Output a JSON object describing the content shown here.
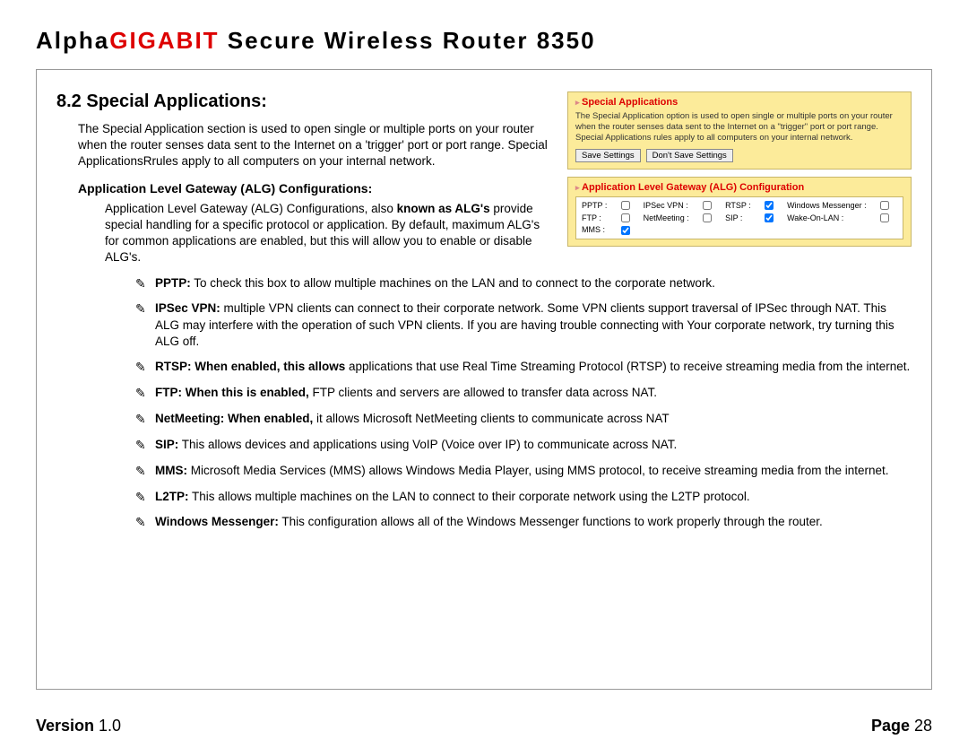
{
  "header": {
    "brand1": "Alpha",
    "brand2": "GIGABIT",
    "product": " Secure Wireless Router 8350"
  },
  "section": {
    "title": "8.2 Special Applications:"
  },
  "intro": "The Special Application section is used to open single or multiple ports on your router when the router senses data sent to the Internet on a 'trigger' port  or port range. Special ApplicationsRrules apply to all computers on your internal network.",
  "alg_heading": "Application Level Gateway (ALG) Configurations:",
  "alg_intro_pre": "Application Level Gateway (ALG) Configurations, also ",
  "alg_intro_bold": "known as ALG's",
  "alg_intro_post": " provide special handling for a specific protocol or application. By default, maximum ALG's for common applications are enabled, but this will allow you to enable or disable  ALG's.",
  "panel1": {
    "title": "Special Applications",
    "desc": "The Special Application option is used to open single or multiple ports on your router when the router senses data sent to the Internet on a \"trigger\" port or port range. Special Applications rules apply to all computers on your internal network.",
    "save": "Save Settings",
    "dont": "Don't Save Settings"
  },
  "panel2": {
    "title": "Application Level Gateway (ALG) Configuration",
    "opts": [
      {
        "label": "PPTP",
        "checked": false
      },
      {
        "label": "IPSec VPN",
        "checked": false
      },
      {
        "label": "RTSP",
        "checked": true
      },
      {
        "label": "Windows Messenger",
        "checked": false
      },
      {
        "label": "FTP",
        "checked": false
      },
      {
        "label": "NetMeeting",
        "checked": false
      },
      {
        "label": "SIP",
        "checked": true
      },
      {
        "label": "Wake-On-LAN",
        "checked": false
      },
      {
        "label": "MMS",
        "checked": true
      }
    ]
  },
  "items": [
    {
      "name": "PPTP:",
      "bold_lead": "",
      "text": " To check this box to allow multiple machines on the LAN and to connect to the corporate network."
    },
    {
      "name": "IPSec VPN:",
      "bold_lead": "",
      "text": " multiple VPN clients can connect to their corporate network. Some VPN clients support traversal of IPSec through NAT. This ALG may interfere with the operation of such VPN clients. If you are having trouble connecting with Your corporate network, try turning this ALG off."
    },
    {
      "name": "RTSP:",
      "bold_lead": " When enabled, this allows",
      "text": " applications that use Real Time Streaming Protocol (RTSP) to receive streaming media from the  internet."
    },
    {
      "name": "FTP:",
      "bold_lead": " When this is enabled,",
      "text": " FTP clients and servers are allowed to transfer data across NAT."
    },
    {
      "name": "NetMeeting:",
      "bold_lead": " When enabled,",
      "text": " it allows Microsoft NetMeeting clients to communicate across NAT"
    },
    {
      "name": "SIP:",
      "bold_lead": "",
      "text": " This allows devices and applications using VoIP (Voice over IP) to communicate across NAT."
    },
    {
      "name": "MMS:",
      "bold_lead": "",
      "text": "  Microsoft Media Services (MMS) allows Windows Media Player, using MMS protocol, to receive streaming media from the internet."
    },
    {
      "name": "L2TP:",
      "bold_lead": "",
      "text": " This allows multiple machines on the LAN to connect to their corporate network using the L2TP protocol."
    },
    {
      "name": "Windows Messenger:",
      "bold_lead": "",
      "text": " This configuration allows all of the Windows Messenger functions to work properly through the router."
    }
  ],
  "footer": {
    "version_label": "Version ",
    "version": "1.0",
    "page_label": "Page ",
    "page": "28"
  },
  "pencil": "✎"
}
